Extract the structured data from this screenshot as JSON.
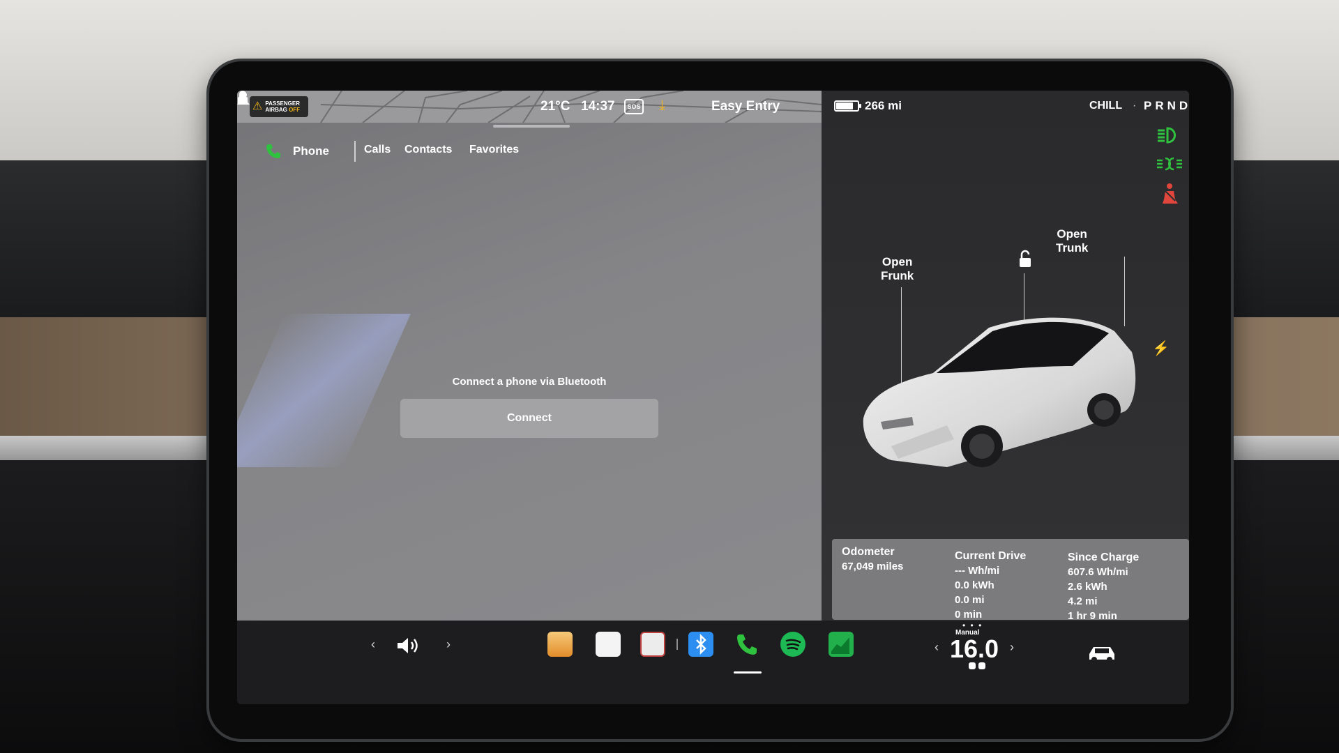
{
  "status_bar": {
    "airbag_label_line1": "PASSENGER",
    "airbag_label_line2": "AIRBAG",
    "airbag_label_off": "OFF",
    "temperature": "21°C",
    "time": "14:37",
    "sos": "SOS",
    "profile": "Easy Entry",
    "range": "266 mi",
    "battery_level": 0.8,
    "drive_mode": "CHILL",
    "separator": "·",
    "gear": "PRND"
  },
  "phone": {
    "title": "Phone",
    "tabs": [
      "Calls",
      "Contacts",
      "Favorites"
    ],
    "message": "Connect a phone via Bluetooth",
    "connect_label": "Connect"
  },
  "vehicle": {
    "open_frunk_line1": "Open",
    "open_frunk_line2": "Frunk",
    "open_trunk_line1": "Open",
    "open_trunk_line2": "Trunk"
  },
  "stats": {
    "odometer": {
      "title": "Odometer",
      "value": "67,049 miles"
    },
    "current_drive": {
      "title": "Current Drive",
      "rows": [
        "--- Wh/mi",
        "0.0 kWh",
        "0.0 mi",
        "0 min"
      ]
    },
    "since_charge": {
      "title": "Since Charge",
      "rows": [
        "607.6 Wh/mi",
        "2.6 kWh",
        "4.2 mi",
        "1 hr 9 min"
      ]
    }
  },
  "dock": {
    "climate_mode": "Manual",
    "cabin_temp": "16.0",
    "prev": "‹",
    "next": "›"
  },
  "colors": {
    "accent_green": "#2fc23f",
    "warning_yellow": "#f2b51a",
    "seatbelt_red": "#e0463c"
  }
}
